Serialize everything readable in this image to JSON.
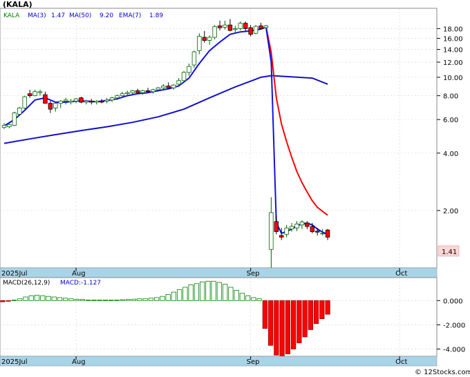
{
  "chart_data": [
    {
      "type": "candlestick",
      "title": "(KALA)",
      "yscale": "log",
      "ylim": [
        1.0,
        23.0
      ],
      "yticks": [
        "18.00",
        "16.00",
        "14.00",
        "12.00",
        "10.00",
        "8.00",
        "6.00",
        "4.00",
        "2.00"
      ],
      "ytick_values": [
        18,
        16,
        14,
        12,
        10,
        8,
        6,
        4,
        2
      ],
      "last_price_label": "1.41",
      "last_price": 1.41,
      "x_labels": [
        "2025Jul",
        "Aug",
        "Sep",
        "Oct"
      ],
      "x_label_index": [
        0,
        14,
        48,
        77
      ],
      "legend": [
        {
          "label": "KALA",
          "color": "#008000"
        },
        {
          "label": "MA(3)",
          "value": "1.47",
          "color": "#0000cc"
        },
        {
          "label": "MA(50)",
          "value": "9.20",
          "color": "#0000cc"
        },
        {
          "label": "EMA(7)",
          "value": "1.89",
          "color": "#0000cc"
        }
      ],
      "colors": {
        "up": "#008000",
        "down": "#ff0000",
        "ma3": "#1010e0",
        "ma50": "#1010c8",
        "ema7": "#ff0000"
      },
      "ohlc": [
        [
          5.45,
          5.75,
          5.35,
          5.6
        ],
        [
          5.5,
          5.7,
          5.4,
          5.65
        ],
        [
          5.6,
          6.6,
          5.55,
          6.5
        ],
        [
          6.4,
          7.0,
          6.3,
          6.9
        ],
        [
          6.9,
          8.0,
          6.8,
          7.9
        ],
        [
          8.2,
          8.6,
          7.8,
          8.0
        ],
        [
          8.0,
          8.6,
          7.95,
          8.4
        ],
        [
          8.3,
          8.6,
          8.0,
          8.4
        ],
        [
          8.1,
          8.4,
          7.6,
          7.3
        ],
        [
          7.3,
          7.5,
          6.5,
          6.8
        ],
        [
          6.9,
          7.4,
          6.6,
          7.3
        ],
        [
          7.3,
          7.6,
          6.9,
          7.5
        ],
        [
          7.5,
          7.8,
          7.2,
          7.6
        ],
        [
          7.4,
          7.7,
          7.2,
          7.5
        ],
        [
          7.5,
          7.8,
          7.3,
          7.7
        ],
        [
          7.8,
          7.9,
          7.3,
          7.4
        ],
        [
          7.4,
          7.6,
          7.2,
          7.5
        ],
        [
          7.5,
          7.7,
          7.2,
          7.4
        ],
        [
          7.4,
          7.6,
          7.2,
          7.5
        ],
        [
          7.5,
          7.7,
          7.3,
          7.4
        ],
        [
          7.5,
          7.8,
          7.3,
          7.6
        ],
        [
          7.6,
          7.9,
          7.4,
          7.8
        ],
        [
          7.8,
          8.1,
          7.6,
          8.0
        ],
        [
          8.0,
          8.4,
          7.8,
          8.2
        ],
        [
          8.2,
          8.5,
          8.0,
          8.3
        ],
        [
          8.3,
          8.6,
          8.1,
          8.5
        ],
        [
          8.5,
          8.7,
          8.2,
          8.3
        ],
        [
          8.3,
          8.6,
          8.1,
          8.5
        ],
        [
          8.5,
          8.8,
          8.3,
          8.4
        ],
        [
          8.4,
          8.7,
          8.2,
          8.6
        ],
        [
          8.6,
          8.9,
          8.4,
          8.8
        ],
        [
          8.8,
          9.2,
          8.6,
          9.0
        ],
        [
          9.0,
          9.4,
          8.7,
          8.8
        ],
        [
          8.8,
          9.2,
          8.6,
          9.1
        ],
        [
          9.2,
          9.9,
          9.0,
          9.6
        ],
        [
          9.6,
          10.8,
          9.4,
          10.6
        ],
        [
          10.6,
          11.8,
          10.2,
          11.4
        ],
        [
          11.6,
          13.8,
          11.2,
          13.6
        ],
        [
          13.8,
          17.0,
          13.2,
          16.4
        ],
        [
          16.2,
          17.5,
          15.2,
          15.6
        ],
        [
          15.6,
          16.6,
          14.8,
          16.2
        ],
        [
          16.2,
          18.8,
          15.8,
          18.4
        ],
        [
          18.6,
          19.8,
          17.6,
          18.2
        ],
        [
          18.3,
          19.8,
          17.8,
          18.8
        ],
        [
          18.8,
          20.2,
          17.4,
          17.6
        ],
        [
          17.8,
          18.6,
          17.1,
          18.0
        ],
        [
          18.0,
          19.6,
          17.6,
          19.2
        ],
        [
          19.2,
          19.6,
          17.4,
          18.0
        ],
        [
          18.2,
          18.8,
          16.4,
          16.8
        ],
        [
          17.0,
          18.8,
          16.8,
          18.5
        ],
        [
          18.6,
          19.3,
          17.8,
          18.0
        ],
        [
          18.2,
          18.8,
          17.6,
          18.6
        ],
        [
          1.25,
          2.35,
          1.0,
          1.95
        ],
        [
          1.75,
          1.88,
          1.5,
          1.55
        ],
        [
          1.48,
          1.62,
          1.4,
          1.45
        ],
        [
          1.5,
          1.68,
          1.45,
          1.62
        ],
        [
          1.6,
          1.72,
          1.55,
          1.65
        ],
        [
          1.62,
          1.76,
          1.56,
          1.7
        ],
        [
          1.68,
          1.78,
          1.6,
          1.74
        ],
        [
          1.72,
          1.76,
          1.6,
          1.65
        ],
        [
          1.65,
          1.72,
          1.52,
          1.55
        ],
        [
          1.56,
          1.62,
          1.48,
          1.54
        ],
        [
          1.52,
          1.6,
          1.48,
          1.52
        ],
        [
          1.58,
          1.6,
          1.4,
          1.45
        ]
      ],
      "series": [
        {
          "name": "MA(3)",
          "x": [
            0,
            2,
            4,
            6,
            8,
            10,
            12,
            14,
            16,
            18,
            20,
            22,
            24,
            26,
            28,
            30,
            32,
            34,
            36,
            38,
            40,
            42,
            44,
            46,
            48,
            50,
            51,
            52,
            53,
            54,
            55,
            56,
            57,
            58,
            59,
            60,
            61,
            62,
            63
          ],
          "values": [
            5.55,
            6.0,
            6.7,
            7.6,
            7.8,
            7.4,
            7.4,
            7.5,
            7.5,
            7.45,
            7.55,
            7.7,
            8.0,
            8.2,
            8.3,
            8.5,
            8.7,
            9.0,
            9.9,
            11.8,
            13.8,
            15.3,
            16.8,
            17.3,
            17.5,
            17.9,
            18.3,
            12.0,
            1.72,
            1.52,
            1.55,
            1.6,
            1.66,
            1.7,
            1.72,
            1.68,
            1.6,
            1.54,
            1.5
          ]
        },
        {
          "name": "MA(50)",
          "x": [
            0,
            5,
            10,
            15,
            20,
            25,
            30,
            35,
            40,
            45,
            50,
            52,
            60,
            63
          ],
          "values": [
            4.5,
            4.75,
            5.0,
            5.25,
            5.5,
            5.8,
            6.2,
            6.8,
            7.8,
            8.9,
            10.0,
            10.2,
            9.9,
            9.2
          ]
        },
        {
          "name": "EMA(7)",
          "x": [
            51,
            52,
            53,
            54,
            55,
            56,
            57,
            58,
            59,
            60,
            61,
            62,
            63
          ],
          "values": [
            18.4,
            13.5,
            7.8,
            5.7,
            4.6,
            3.8,
            3.2,
            2.8,
            2.5,
            2.25,
            2.08,
            1.98,
            1.89
          ]
        }
      ]
    },
    {
      "type": "bar",
      "title": "MACD(26,12,9)",
      "legend": [
        {
          "label": "MACD(26,12,9)",
          "color": "#000000"
        },
        {
          "label": "MACD:-1.127",
          "color": "#0000cc"
        }
      ],
      "ylim": [
        -4.6,
        1.9
      ],
      "yticks": [
        "0.000",
        "-2.000",
        "-4.000"
      ],
      "ytick_values": [
        0,
        -2,
        -4
      ],
      "x_labels": [
        "2025Jul",
        "Aug",
        "Sep",
        "Oct"
      ],
      "colors": {
        "positive": "#008000",
        "negative": "#ff0000"
      },
      "values": [
        -0.1,
        -0.05,
        0.05,
        0.15,
        0.3,
        0.4,
        0.45,
        0.4,
        0.35,
        0.3,
        0.25,
        0.2,
        0.15,
        0.1,
        0.1,
        0.05,
        0.05,
        0.05,
        0.05,
        0.05,
        0.05,
        0.08,
        0.1,
        0.12,
        0.15,
        0.15,
        0.2,
        0.25,
        0.35,
        0.5,
        0.7,
        0.9,
        1.1,
        1.3,
        1.4,
        1.55,
        1.6,
        1.6,
        1.5,
        1.35,
        1.1,
        0.85,
        0.6,
        0.4,
        0.25,
        0.15,
        -2.3,
        -3.7,
        -4.5,
        -4.7,
        -4.4,
        -4.0,
        -3.5,
        -3.0,
        -2.4,
        -1.9,
        -1.5,
        -1.13
      ]
    }
  ],
  "footer": {
    "watermark": "© 12Stocks.com"
  }
}
